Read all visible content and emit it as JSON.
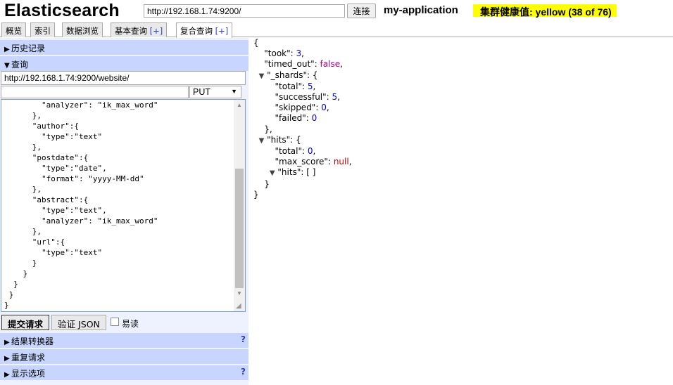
{
  "header": {
    "app_title": "Elasticsearch",
    "connection_url": "http://192.168.1.74:9200/",
    "connect_label": "连接",
    "cluster_name": "my-application",
    "health_text": "集群健康值: yellow (38 of 76)",
    "health_color": "#ffff00"
  },
  "tabs": [
    {
      "label": "概览",
      "plus": ""
    },
    {
      "label": "索引",
      "plus": ""
    },
    {
      "label": "数据浏览",
      "plus": ""
    },
    {
      "label": "基本查询 ",
      "plus": "[+]"
    },
    {
      "label": "复合查询 ",
      "plus": "[+]"
    }
  ],
  "active_tab": "复合查询",
  "left_panel": {
    "history_label": "历史记录",
    "query_label": "查询",
    "query_url": "http://192.168.1.74:9200/website/",
    "query_path": "",
    "method": "PUT",
    "body_text": "        \"analyzer\": \"ik_max_word\"\n      },\n      \"author\":{\n        \"type\":\"text\"\n      },\n      \"postdate\":{\n        \"type\":\"date\",\n        \"format\": \"yyyy-MM-dd\"\n      },\n      \"abstract\":{\n        \"type\":\"text\",\n        \"analyzer\": \"ik_max_word\"\n      },\n      \"url\":{\n        \"type\":\"text\"\n      }\n    }\n  }\n }\n}",
    "submit_label": "提交请求",
    "validate_label": "验证 JSON",
    "pretty_label": "易读",
    "pretty_checked": false,
    "transformer_label": "结果转换器",
    "repeat_label": "重复请求",
    "display_label": "显示选项",
    "help_symbol": "?"
  },
  "response": {
    "took": "3",
    "timed_out": "false",
    "shards_total": "5",
    "shards_successful": "5",
    "shards_skipped": "0",
    "shards_failed": "0",
    "hits_total": "0",
    "hits_max_score": "null",
    "hits_hits": "[ ]"
  },
  "colors": {
    "section_header": "#c8d6ff",
    "left_panel_bg": "#eef2ff",
    "json_number": "#0000cc",
    "json_boolean": "#aa0088",
    "json_null": "#cc0000"
  }
}
